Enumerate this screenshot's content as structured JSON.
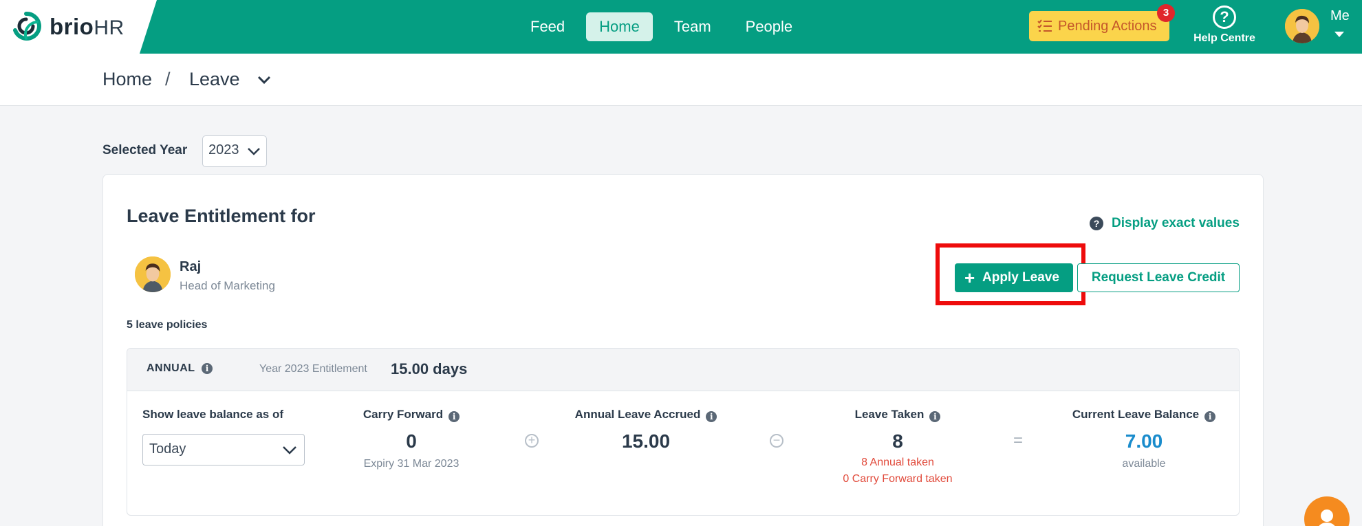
{
  "brand": {
    "name_part1": "brio",
    "name_part2": "HR",
    "colors": {
      "primary": "#059e82",
      "pending": "#fbd44b",
      "badge": "#e0262b",
      "highlight": "#ee0c0c",
      "balance": "#1a8ccc"
    }
  },
  "nav": [
    {
      "label": "Feed",
      "active": false
    },
    {
      "label": "Home",
      "active": true
    },
    {
      "label": "Team",
      "active": false
    },
    {
      "label": "People",
      "active": false
    }
  ],
  "pending_actions": {
    "label": "Pending Actions",
    "count": "3",
    "icon": "checklist-icon"
  },
  "help": {
    "label": "Help Centre",
    "icon": "question-circle-icon"
  },
  "me": {
    "label": "Me"
  },
  "breadcrumb": {
    "root": "Home",
    "separator": "/",
    "current": "Leave"
  },
  "year_filter": {
    "label": "Selected Year",
    "value": "2023"
  },
  "entitlement": {
    "title": "Leave Entitlement for",
    "display_exact": "Display exact values",
    "employee": {
      "name": "Raj",
      "role": "Head of Marketing"
    },
    "apply_button": "Apply Leave",
    "credit_button": "Request Leave Credit",
    "policies_count": "5 leave policies"
  },
  "policy": {
    "name": "ANNUAL",
    "entitlement_label": "Year 2023 Entitlement",
    "entitlement_value": "15.00 days",
    "show_as_label": "Show leave balance as of",
    "show_as_value": "Today",
    "carry_forward": {
      "label": "Carry Forward",
      "value": "0",
      "sub": "Expiry 31 Mar 2023"
    },
    "accrued": {
      "label": "Annual Leave Accrued",
      "value": "15.00"
    },
    "taken": {
      "label": "Leave Taken",
      "value": "8",
      "annual_taken": "8 Annual taken",
      "cf_taken": "0 Carry Forward taken"
    },
    "balance": {
      "label": "Current Leave Balance",
      "value": "7.00",
      "sub": "available"
    },
    "operators": {
      "plus": "+",
      "minus": "−",
      "equals": "="
    }
  }
}
